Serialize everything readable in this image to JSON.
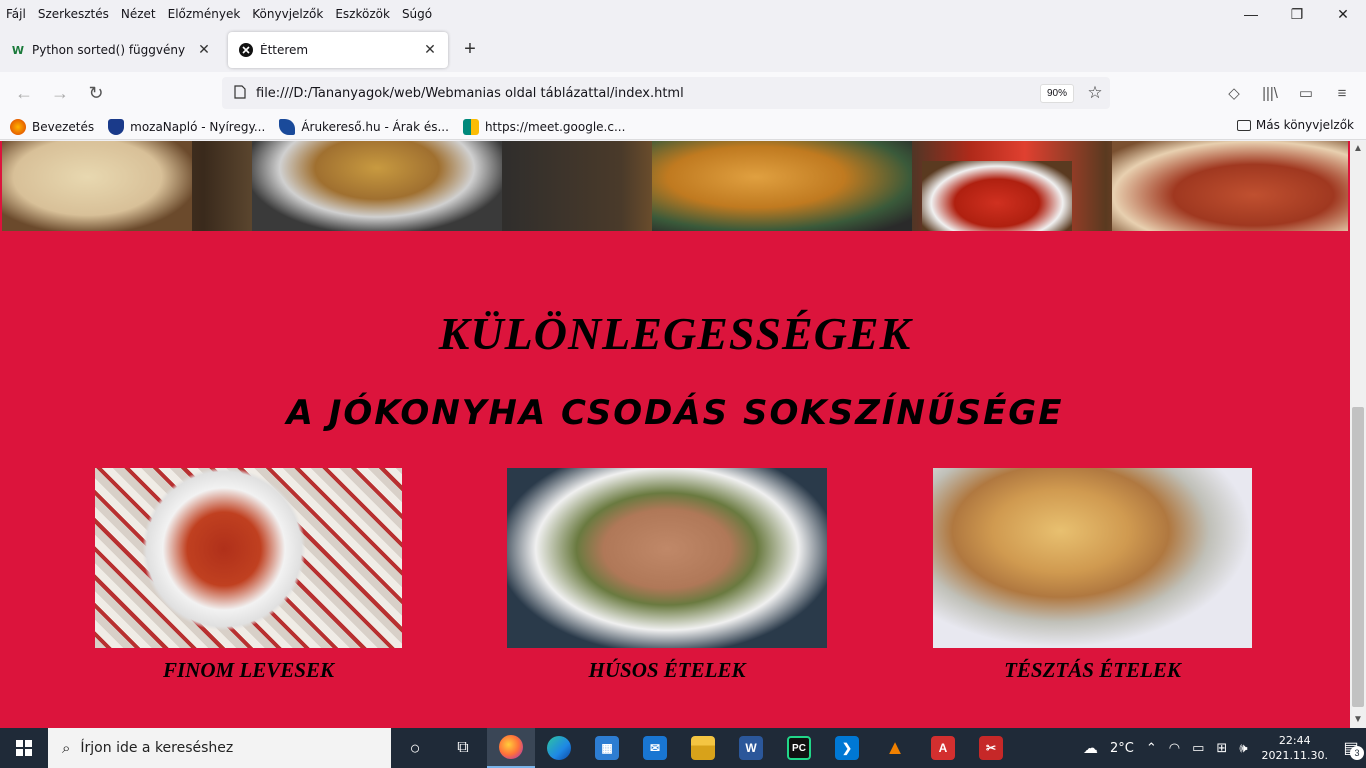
{
  "menubar": {
    "items": [
      "Fájl",
      "Szerkesztés",
      "Nézet",
      "Előzmények",
      "Könyvjelzők",
      "Eszközök",
      "Súgó"
    ],
    "minimize": "—",
    "restore": "❐",
    "close": "✕"
  },
  "tabs": [
    {
      "label": "Python sorted() függvény",
      "icon": "wiki-icon",
      "close": "✕"
    },
    {
      "label": "Étterem",
      "icon": "site-close-icon",
      "close": "✕"
    }
  ],
  "newtab": "+",
  "navbar": {
    "back": "←",
    "forward": "→",
    "reload": "↻",
    "url": "file:///D:/Tananyagok/web/Webmanias oldal táblázattal/index.html",
    "zoom": "90%",
    "star": "☆",
    "pocket": "◇",
    "library": "|||\\",
    "sidebar": "▭",
    "menu": "≡"
  },
  "bookmarks": {
    "items": [
      {
        "label": "Bevezetés",
        "color": "#e66000"
      },
      {
        "label": "mozaNapló - Nyíregy...",
        "color": "#1a3a8a"
      },
      {
        "label": "Árukereső.hu - Árak és...",
        "color": "#1a4a9a"
      },
      {
        "label": "https://meet.google.c...",
        "color": "#00897b"
      }
    ],
    "other": "Más könyvjelzők"
  },
  "page": {
    "heading": "KÜLÖNLEGESSÉGEK",
    "subheading": "A JÓKONYHA CSODÁS SOKSZÍNŰSÉGE",
    "background_color": "#dc143c",
    "cards": [
      {
        "caption": "FINOM LEVESEK"
      },
      {
        "caption": "HÚSOS ÉTELEK"
      },
      {
        "caption": "TÉSZTÁS ÉTELEK"
      }
    ]
  },
  "taskbar": {
    "search_placeholder": "Írjon ide a kereséshez",
    "weather": "2°C",
    "time": "22:44",
    "date": "2021.11.30.",
    "notifications": "3",
    "apps": [
      {
        "name": "cortana-icon",
        "glyph": "○",
        "color": "transparent"
      },
      {
        "name": "task-view-icon",
        "glyph": "⧉",
        "color": "transparent"
      },
      {
        "name": "firefox-icon",
        "glyph": "",
        "color": "#ff7139"
      },
      {
        "name": "edge-icon",
        "glyph": "",
        "color": "#1e88e5"
      },
      {
        "name": "store-icon",
        "glyph": "▦",
        "color": "#2d7dd2"
      },
      {
        "name": "mail-icon",
        "glyph": "✉",
        "color": "#1976d2"
      },
      {
        "name": "file-explorer-icon",
        "glyph": "",
        "color": "#f4c542"
      },
      {
        "name": "word-icon",
        "glyph": "W",
        "color": "#2b579a"
      },
      {
        "name": "pycharm-icon",
        "glyph": "PC",
        "color": "#111"
      },
      {
        "name": "vscode-icon",
        "glyph": "❯",
        "color": "#0078d4"
      },
      {
        "name": "vlc-icon",
        "glyph": "▲",
        "color": "#f08000"
      },
      {
        "name": "acrobat-icon",
        "glyph": "A",
        "color": "#d32f2f"
      },
      {
        "name": "snipping-icon",
        "glyph": "✂",
        "color": "#c62828"
      }
    ]
  }
}
